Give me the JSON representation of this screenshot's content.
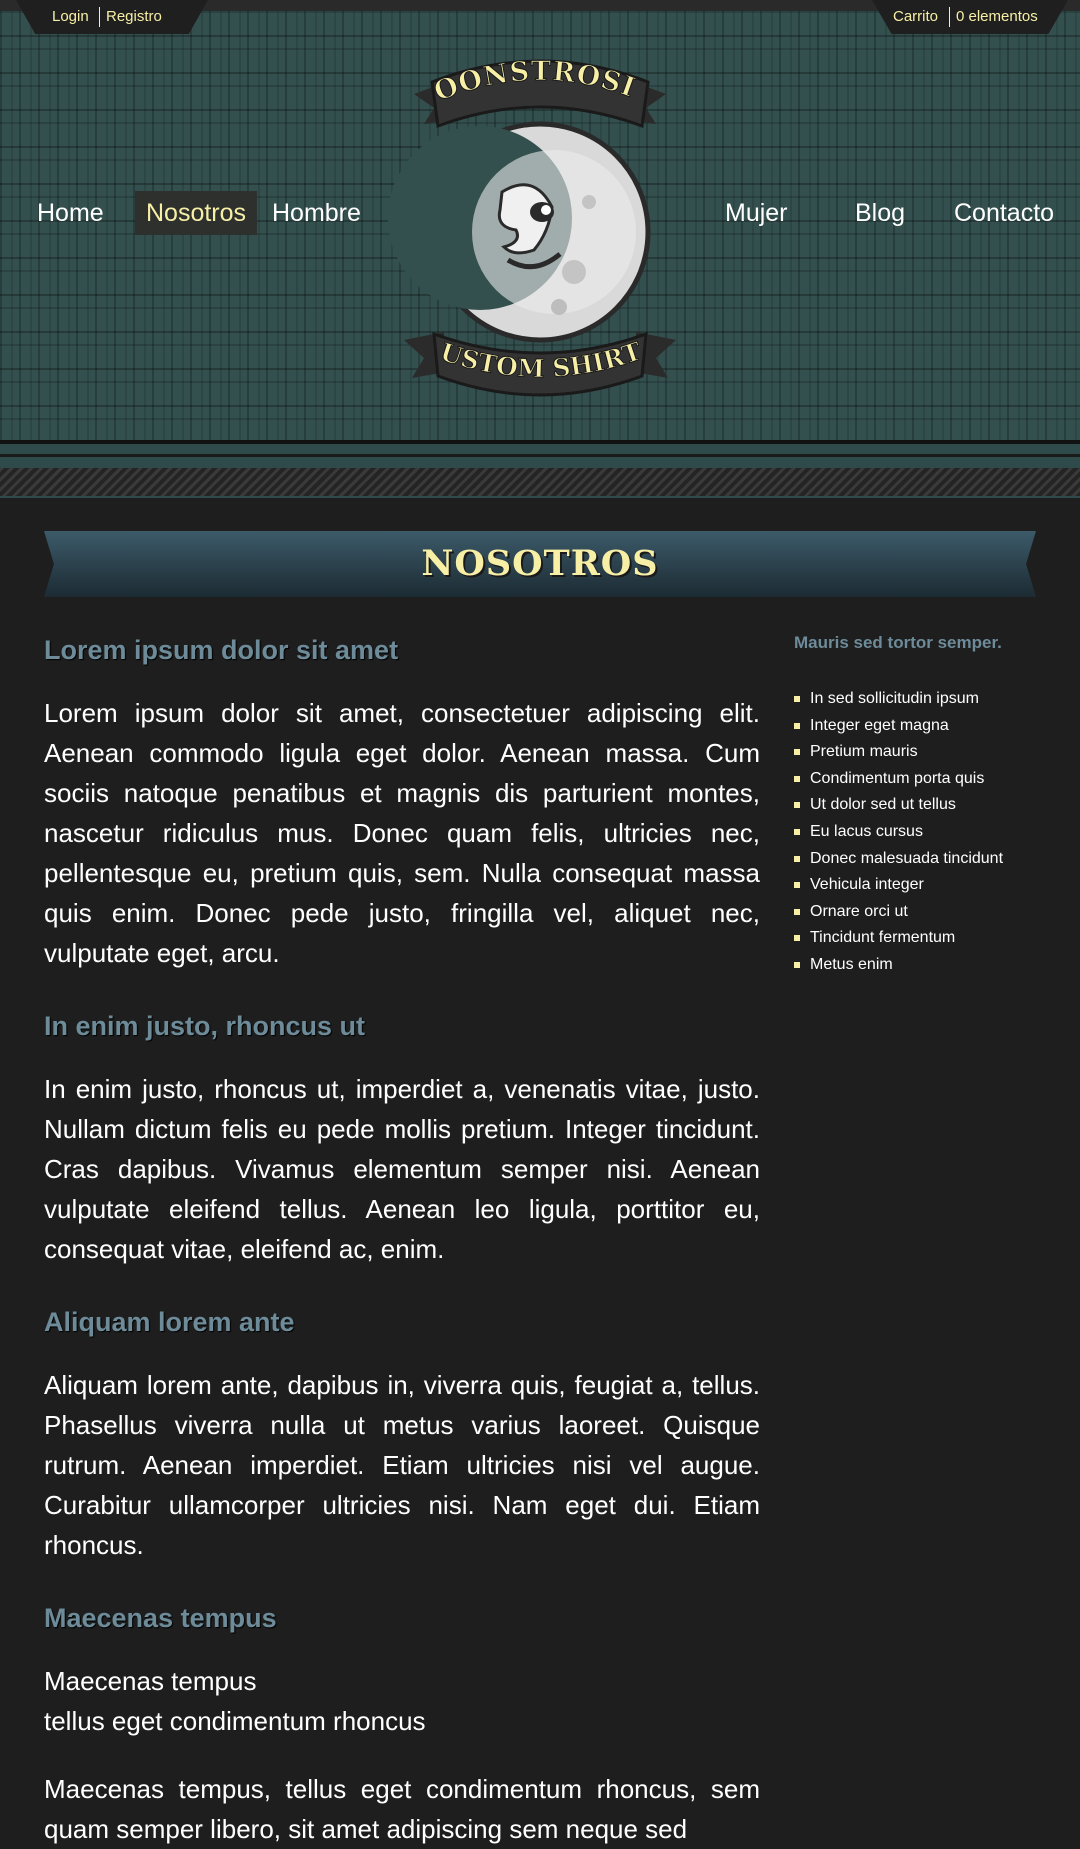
{
  "topbar": {
    "login": "Login",
    "register": "Registro",
    "cart": "Carrito",
    "cart_count": "0 elementos"
  },
  "nav": {
    "home": "Home",
    "about": "Nosotros",
    "men": "Hombre",
    "women": "Mujer",
    "blog": "Blog",
    "contact": "Contacto"
  },
  "logo": {
    "top_text": "MOONSTROSITY",
    "bottom_text": "CUSTOM SHIRTS"
  },
  "page": {
    "title": "NOSOTROS"
  },
  "sections": [
    {
      "heading": "Lorem ipsum dolor sit amet",
      "paragraph": "Lorem ipsum dolor sit amet, consectetuer adipiscing elit. Aenean commodo ligula eget dolor. Aenean massa. Cum sociis natoque penatibus et magnis dis parturient montes, nascetur ridiculus mus. Donec quam felis, ultricies nec, pellentesque eu, pretium quis, sem. Nulla consequat massa quis enim. Donec pede justo, fringilla vel, aliquet nec, vulputate eget, arcu."
    },
    {
      "heading": "In enim justo, rhoncus ut",
      "paragraph": "In enim justo, rhoncus ut, imperdiet a, venenatis vitae, justo. Nullam dictum felis eu pede mollis pretium. Integer tincidunt. Cras dapibus. Vivamus elementum semper nisi. Aenean vulputate eleifend tellus. Aenean leo ligula, porttitor eu, consequat vitae, eleifend ac, enim."
    },
    {
      "heading": "Aliquam lorem ante",
      "paragraph": "Aliquam lorem ante, dapibus in, viverra quis, feugiat a, tellus. Phasellus viverra nulla ut metus varius laoreet. Quisque rutrum. Aenean imperdiet. Etiam ultricies nisi vel augue. Curabitur ullamcorper ultricies nisi. Nam eget dui. Etiam rhoncus."
    },
    {
      "heading": "Maecenas tempus",
      "line1": "Maecenas tempus",
      "line2": "tellus eget condimentum rhoncus",
      "paragraph": "Maecenas tempus, tellus eget condimentum rhoncus, sem quam semper libero, sit amet adipiscing sem neque sed"
    }
  ],
  "sidebar": {
    "title": "Mauris sed tortor semper.",
    "items": [
      "In sed sollicitudin ipsum",
      "Integer eget magna",
      "Pretium mauris",
      "Condimentum porta quis",
      "Ut dolor sed ut tellus",
      "Eu lacus cursus",
      "Donec malesuada tincidunt",
      "Vehicula integer",
      "Ornare orci ut",
      "Tincidunt fermentum",
      "Metus enim"
    ]
  },
  "colors": {
    "accent_yellow": "#f7efa6",
    "heading_blue": "#6d8b99",
    "header_teal": "#33504f",
    "page_bg": "#1e1e1e"
  }
}
